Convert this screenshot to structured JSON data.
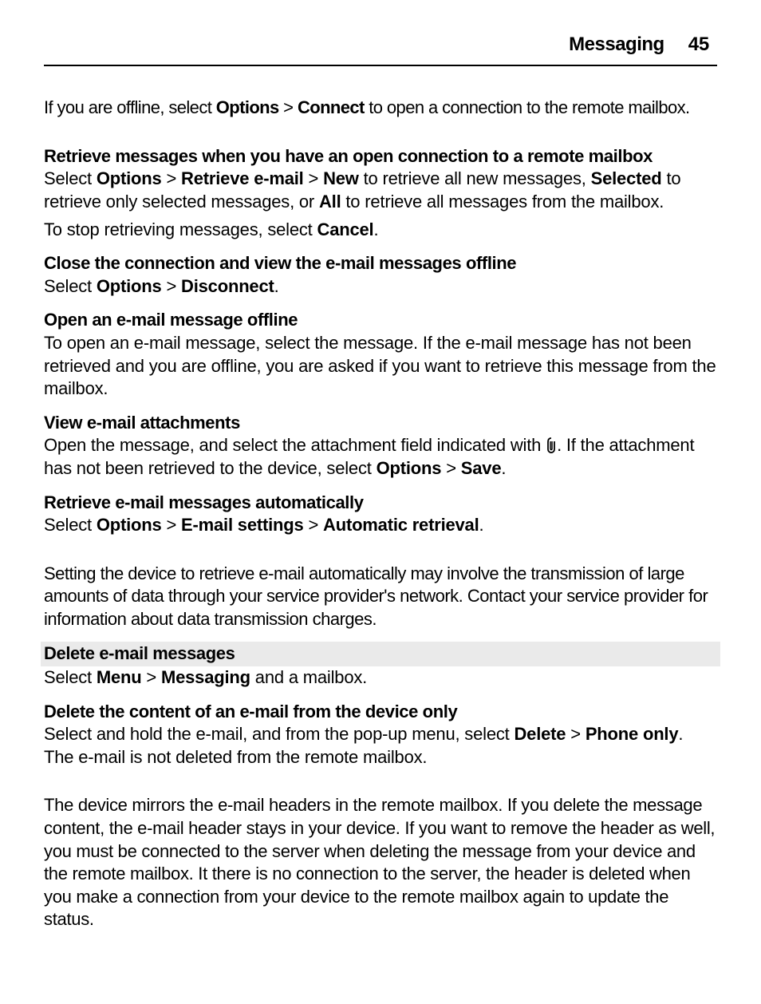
{
  "header": {
    "title": "Messaging",
    "page": "45"
  },
  "intro": {
    "t1": "If you are offline, select ",
    "b1": "Options",
    "t2": "  > ",
    "b2": "Connect",
    "t3": " to open a connection to the remote mailbox."
  },
  "retrieve": {
    "heading": "Retrieve messages when you have an open connection to a remote mailbox",
    "line1": {
      "t1": "Select ",
      "b1": "Options",
      "t2": "  > ",
      "b2": "Retrieve e-mail",
      "t3": "  > ",
      "b3": "New",
      "t4": " to retrieve all new messages, ",
      "b4": "Selected",
      "t5": " to retrieve only selected messages, or ",
      "b5": "All",
      "t6": " to retrieve all messages from the mailbox."
    },
    "line2": {
      "t1": "To stop retrieving messages, select ",
      "b1": "Cancel",
      "t2": "."
    }
  },
  "close": {
    "heading": "Close the connection and view the e-mail messages offline",
    "line1": {
      "t1": "Select ",
      "b1": "Options",
      "t2": "  > ",
      "b2": "Disconnect",
      "t3": "."
    }
  },
  "openoffline": {
    "heading": "Open an e-mail message offline",
    "para": "To open an e-mail message, select the message. If the e-mail message has not been retrieved and you are offline, you are asked if you want to retrieve this message from the mailbox."
  },
  "attach": {
    "heading": "View e-mail attachments",
    "line1": {
      "t1": "Open the message, and select the attachment field indicated with ",
      "t2": ". If the attachment has not been retrieved to the device, select ",
      "b1": "Options",
      "t3": "  > ",
      "b2": "Save",
      "t4": "."
    }
  },
  "auto": {
    "heading": "Retrieve e-mail messages automatically",
    "line1": {
      "t1": "Select ",
      "b1": "Options",
      "t2": "  > ",
      "b2": "E-mail settings",
      "t3": "  > ",
      "b3": "Automatic retrieval",
      "t4": "."
    },
    "para2": "Setting the device to retrieve e-mail automatically may involve the transmission of large amounts of data through your service provider's network. Contact your service provider for information about data transmission charges."
  },
  "delete": {
    "heading": "Delete e-mail messages",
    "line1": {
      "t1": "Select ",
      "b1": "Menu",
      "t2": "  > ",
      "b2": "Messaging",
      "t3": " and a mailbox."
    }
  },
  "deletedevice": {
    "heading": "Delete the content of an e-mail from the device only",
    "line1": {
      "t1": "Select and hold the e-mail, and from the pop-up menu, select ",
      "b1": "Delete",
      "t2": "  > ",
      "b2": "Phone only",
      "t3": ". The e-mail is not deleted from the remote mailbox."
    },
    "para2": "The device mirrors the e-mail headers in the remote mailbox. If you delete the message content, the e-mail header stays in your device. If you want to remove the header as well, you must be connected to the server when deleting the message from your device and the remote mailbox. It there is no connection to the server, the header is deleted when you make a connection from your device to the remote mailbox again to update the status."
  }
}
